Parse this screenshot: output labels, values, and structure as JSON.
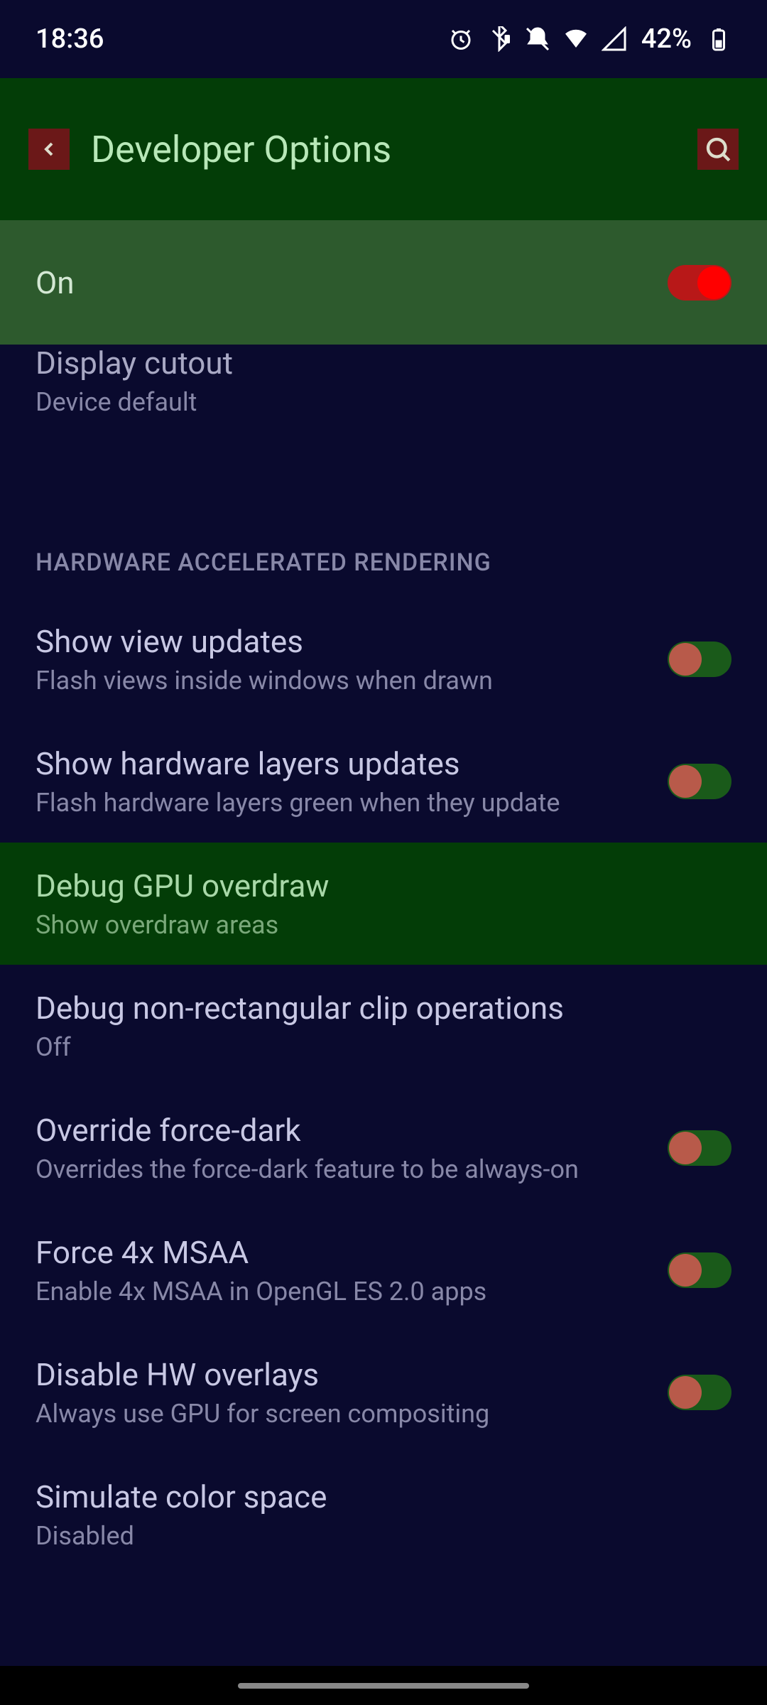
{
  "status": {
    "time": "18:36",
    "battery": "42%"
  },
  "app_bar": {
    "title": "Developer Options"
  },
  "master": {
    "label": "On",
    "state": true
  },
  "clipped": {
    "title": "Display cutout",
    "value": "Device default"
  },
  "section": {
    "header": "HARDWARE ACCELERATED RENDERING"
  },
  "settings": [
    {
      "title": "Show view updates",
      "desc": "Flash views inside windows when drawn",
      "toggle": true
    },
    {
      "title": "Show hardware layers updates",
      "desc": "Flash hardware layers green when they update",
      "toggle": true
    },
    {
      "title": "Debug GPU overdraw",
      "desc": "Show overdraw areas",
      "highlighted": true
    },
    {
      "title": "Debug non-rectangular clip operations",
      "desc": "Off"
    },
    {
      "title": "Override force-dark",
      "desc": "Overrides the force-dark feature to be always-on",
      "toggle": true
    },
    {
      "title": "Force 4x MSAA",
      "desc": "Enable 4x MSAA in OpenGL ES 2.0 apps",
      "toggle": true
    },
    {
      "title": "Disable HW overlays",
      "desc": "Always use GPU for screen compositing",
      "toggle": true
    },
    {
      "title": "Simulate color space",
      "desc": "Disabled"
    }
  ]
}
